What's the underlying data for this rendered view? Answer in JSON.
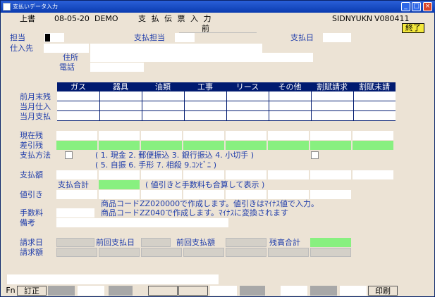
{
  "window": {
    "title": "支払いデータ入力",
    "controls": [
      "_",
      "□",
      "×"
    ]
  },
  "header": {
    "mode": "上書",
    "date": "08-05-20",
    "env": "DEMO",
    "screen_title": "支 払 伝 票 入 力",
    "page_label": "前",
    "program_id": "SIDNYUKN",
    "version": "V080411",
    "end_button": "終了"
  },
  "form": {
    "tantou_label": "担当",
    "shiharai_tantou_label": "支払担当",
    "shiharai_bi_label": "支払日",
    "shiiresaki_label": "仕入先",
    "jusho_label": "住所",
    "denwa_label": "電話"
  },
  "grid": {
    "columns": [
      "ガス",
      "器具",
      "油類",
      "工事",
      "リース",
      "その他",
      "割賦請求",
      "割賦未請"
    ],
    "rows": [
      "前月末残",
      "当月仕入",
      "当月支払"
    ]
  },
  "lower": {
    "genzai_zan_label": "現在残",
    "sashihiki_zan_label": "差引残",
    "shiharai_houhou_label": "支払方法",
    "methods_line1": "( 1. 現金  2. 郵便振込  3. 銀行振込  4. 小切手   )",
    "methods_line2": "( 5. 自振  6. 手形     7. 相殺     9.ｺﾝﾋﾞﾆ      )",
    "shiharai_gaku_label": "支払額",
    "shiharai_goukei_label": "支払合計",
    "goukei_note": "( 値引きと手数料も合算して表示 )",
    "nebiki_label": "値引き",
    "nebiki_note": "商品コードZZ020000で作成します。値引きはﾏｲﾅｽ値で入力。",
    "tesuryo_label": "手数料",
    "tesuryo_note": "商品コードZZ040で作成します。ﾏｲﾅｽに変換されます",
    "bikou_label": "備考",
    "seikyu_bi_label": "請求日",
    "zenkai_shiharai_bi_label": "前回支払日",
    "zenkai_shiharai_gaku_label": "前回支払額",
    "zandaka_goukei_label": "残高合計",
    "seikyu_gaku_label": "請求額"
  },
  "fkeys": {
    "fn_label": "Fn",
    "f1": "訂正",
    "f12": "印刷"
  }
}
